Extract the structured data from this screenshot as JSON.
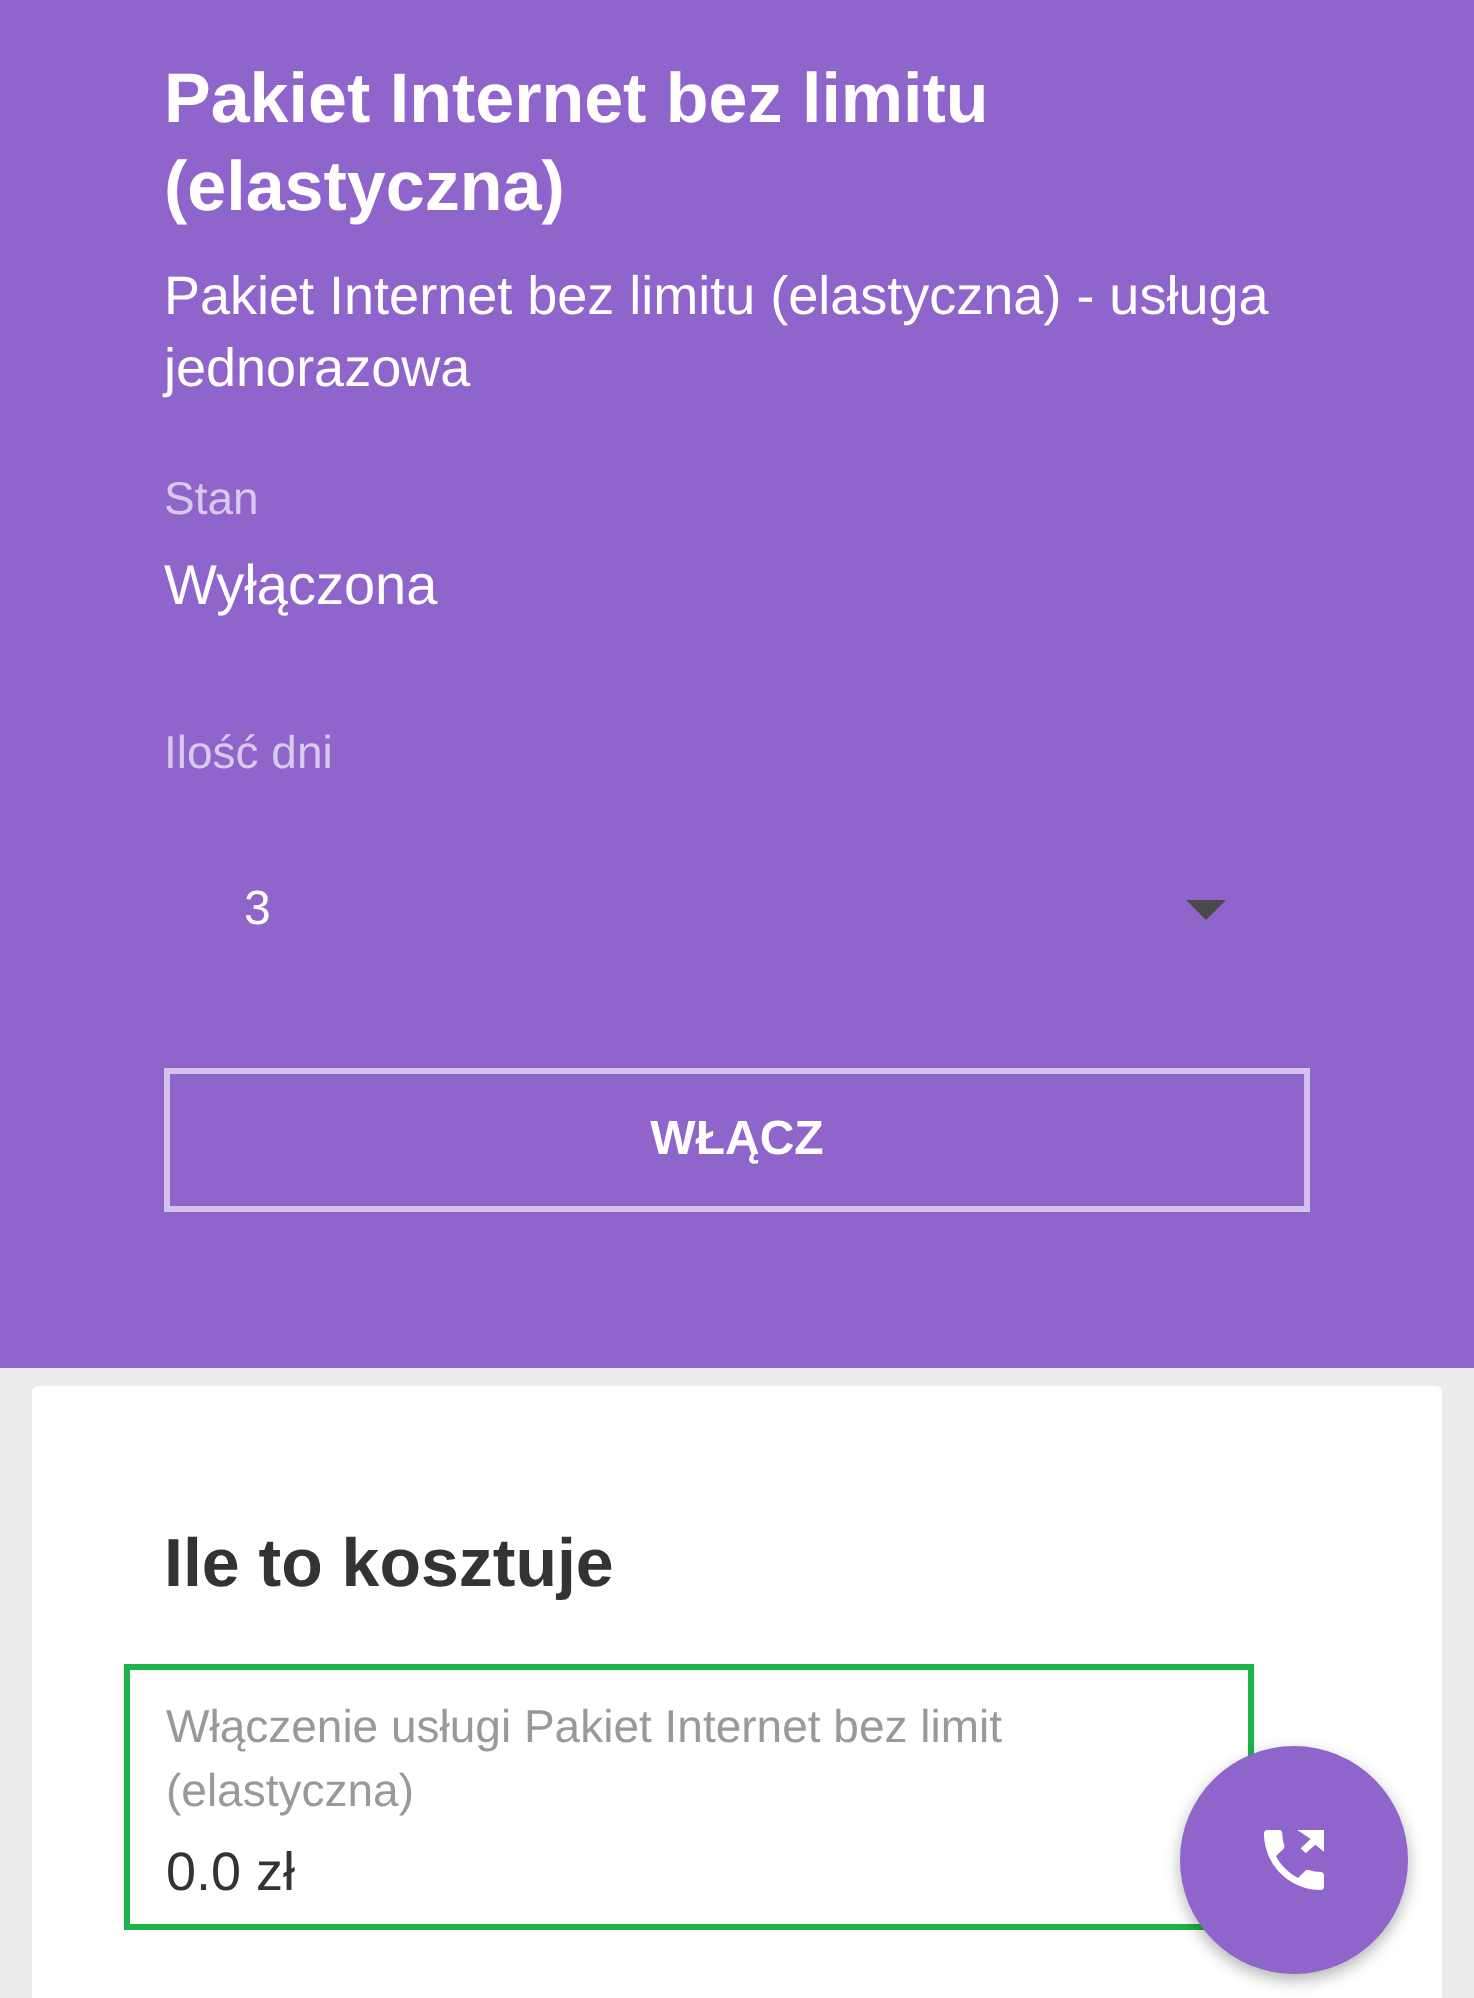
{
  "header": {
    "title": "Pakiet Internet bez limitu (elastyczna)",
    "description": "Pakiet Internet bez limitu (elastyczna) - usługa jednorazowa",
    "status": {
      "label": "Stan",
      "value": "Wyłączona"
    },
    "days_select": {
      "label": "Ilość dni",
      "value": "3"
    },
    "button": "WŁĄCZ"
  },
  "cost_card": {
    "title": "Ile to kosztuje",
    "items": [
      {
        "label": "Włączenie usługi Pakiet Internet bez limit",
        "sublabel": "(elastyczna)",
        "price": "0.0 zł",
        "highlighted": true
      }
    ]
  }
}
